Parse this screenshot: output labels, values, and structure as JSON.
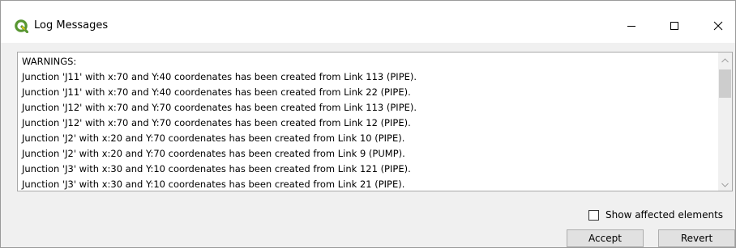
{
  "window": {
    "title": "Log Messages",
    "icon": "qgis-logo-icon",
    "controls": [
      "minimize-icon",
      "maximize-icon",
      "close-icon"
    ]
  },
  "log": {
    "lines": [
      "WARNINGS:",
      "Junction 'J11' with x:70 and Y:40 coordenates has been created from Link 113 (PIPE).",
      "Junction 'J11' with x:70 and Y:40 coordenates has been created from Link 22 (PIPE).",
      "Junction 'J12' with x:70 and Y:70 coordenates has been created from Link 113 (PIPE).",
      "Junction 'J12' with x:70 and Y:70 coordenates has been created from Link 12 (PIPE).",
      "Junction 'J2' with x:20 and Y:70 coordenates has been created from Link 10 (PIPE).",
      "Junction 'J2' with x:20 and Y:70 coordenates has been created from Link 9 (PUMP).",
      "Junction 'J3' with x:30 and Y:10 coordenates has been created from Link 121 (PIPE).",
      "Junction 'J3' with x:30 and Y:10 coordenates has been created from Link 21 (PIPE)."
    ]
  },
  "options": {
    "show_affected_label": "Show affected elements",
    "show_affected_checked": false
  },
  "buttons": {
    "accept": "Accept",
    "revert": "Revert"
  },
  "colors": {
    "qgis_green": "#589632",
    "qgis_yellow": "#eec90d"
  }
}
